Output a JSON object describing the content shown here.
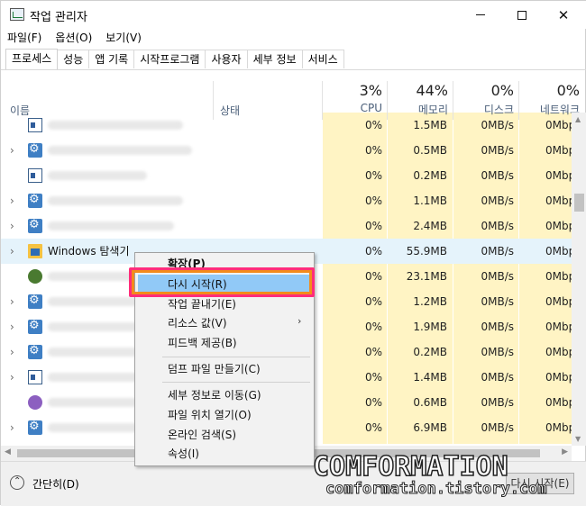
{
  "window": {
    "title": "작업 관리자"
  },
  "menu": [
    "파일(F)",
    "옵션(O)",
    "보기(V)"
  ],
  "tabs": [
    "프로세스",
    "성능",
    "앱 기록",
    "시작프로그램",
    "사용자",
    "세부 정보",
    "서비스"
  ],
  "columns": {
    "name": "이름",
    "status": "상태",
    "cpu": {
      "pct": "3%",
      "label": "CPU"
    },
    "memory": {
      "pct": "44%",
      "label": "메모리"
    },
    "disk": {
      "pct": "0%",
      "label": "디스크"
    },
    "network": {
      "pct": "0%",
      "label": "네트워크"
    }
  },
  "rows": [
    {
      "icon": "window-icon",
      "name": "",
      "cpu": "0%",
      "memory": "1.5MB",
      "disk": "0MB/s",
      "network": "0Mbp"
    },
    {
      "icon": "gear-icon",
      "name": "",
      "cpu": "0%",
      "memory": "0.5MB",
      "disk": "0MB/s",
      "network": "0Mbp"
    },
    {
      "icon": "window-icon",
      "name": "",
      "cpu": "0%",
      "memory": "0.2MB",
      "disk": "0MB/s",
      "network": "0Mbp"
    },
    {
      "icon": "gear-icon",
      "name": "",
      "cpu": "0%",
      "memory": "1.1MB",
      "disk": "0MB/s",
      "network": "0Mbp"
    },
    {
      "icon": "gear-icon",
      "name": "",
      "cpu": "0%",
      "memory": "2.4MB",
      "disk": "0MB/s",
      "network": "0Mbp"
    },
    {
      "icon": "folder-icon",
      "name": "Windows 탐색기",
      "cpu": "0%",
      "memory": "55.9MB",
      "disk": "0MB/s",
      "network": "0Mbp"
    },
    {
      "icon": "circle-icon",
      "name": "",
      "cpu": "0%",
      "memory": "23.1MB",
      "disk": "0MB/s",
      "network": "0Mbp"
    },
    {
      "icon": "gear-icon",
      "name": "",
      "cpu": "0%",
      "memory": "1.2MB",
      "disk": "0MB/s",
      "network": "0Mbp"
    },
    {
      "icon": "gear-icon",
      "name": "",
      "cpu": "0%",
      "memory": "1.9MB",
      "disk": "0MB/s",
      "network": "0Mbp"
    },
    {
      "icon": "gear-icon",
      "name": "",
      "cpu": "0%",
      "memory": "0.2MB",
      "disk": "0MB/s",
      "network": "0Mbp"
    },
    {
      "icon": "window-icon",
      "name": "",
      "cpu": "0%",
      "memory": "1.4MB",
      "disk": "0MB/s",
      "network": "0Mbp"
    },
    {
      "icon": "circle-icon",
      "name": "",
      "cpu": "0%",
      "memory": "0.6MB",
      "disk": "0MB/s",
      "network": "0Mbp"
    },
    {
      "icon": "gear-icon",
      "name": "",
      "cpu": "0%",
      "memory": "6.9MB",
      "disk": "0MB/s",
      "network": "0Mbp"
    }
  ],
  "context_menu": {
    "items": [
      "확장(P)",
      "다시 시작(R)",
      "작업 끝내기(E)",
      "리소스 값(V)",
      "피드백 제공(B)",
      "덤프 파일 만들기(C)",
      "세부 정보로 이동(G)",
      "파일 위치 열기(O)",
      "온라인 검색(S)",
      "속성(I)"
    ],
    "highlighted": "다시 시작(R)"
  },
  "footer": {
    "collapse": "간단히(D)",
    "button": "다시 시작(E)"
  },
  "watermark": {
    "title": "COMFORMATION",
    "url": "comformation.tistory.com"
  },
  "colors": {
    "metric_bg": "#fff4c4",
    "selected_row": "#e5f3fb",
    "menu_highlight": "#91c9f7",
    "annotation_pink": "#ff2d7a",
    "annotation_orange": "#f38b1c"
  }
}
